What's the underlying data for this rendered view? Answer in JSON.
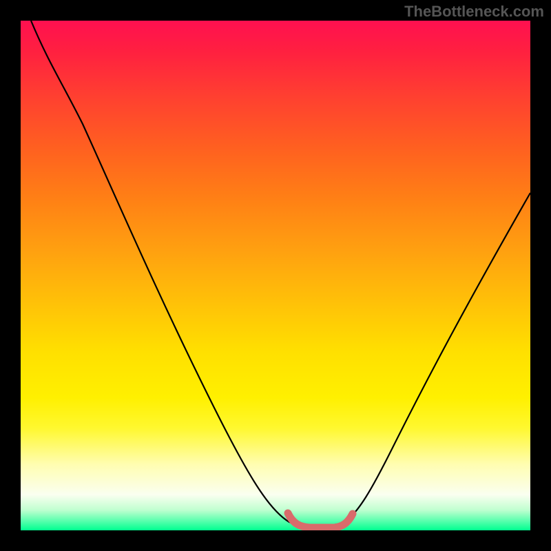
{
  "watermark": "TheBottleneck.com",
  "chart_data": {
    "type": "line",
    "title": "",
    "xlabel": "",
    "ylabel": "",
    "xlim": [
      0,
      100
    ],
    "ylim": [
      0,
      100
    ],
    "series": [
      {
        "name": "bottleneck-curve",
        "color": "#000000",
        "x_pct": [
          2,
          8,
          15,
          22,
          30,
          38,
          45,
          50,
          53,
          57,
          62,
          66,
          70,
          78,
          86,
          94,
          100
        ],
        "y_pct": [
          100,
          89,
          78,
          66,
          53,
          39,
          25,
          13,
          6,
          1,
          1,
          6,
          15,
          30,
          45,
          58,
          67
        ]
      },
      {
        "name": "valley-highlight",
        "color": "#d96b6b",
        "x_pct": [
          53,
          55,
          57,
          60,
          62,
          64
        ],
        "y_pct": [
          3.5,
          1,
          0.5,
          0.5,
          1,
          3.5
        ]
      }
    ],
    "gradient_stops": [
      {
        "pct": 0,
        "color": "#ff1050"
      },
      {
        "pct": 25,
        "color": "#ff6020"
      },
      {
        "pct": 55,
        "color": "#ffc008"
      },
      {
        "pct": 80,
        "color": "#fff830"
      },
      {
        "pct": 100,
        "color": "#00ff90"
      }
    ]
  }
}
